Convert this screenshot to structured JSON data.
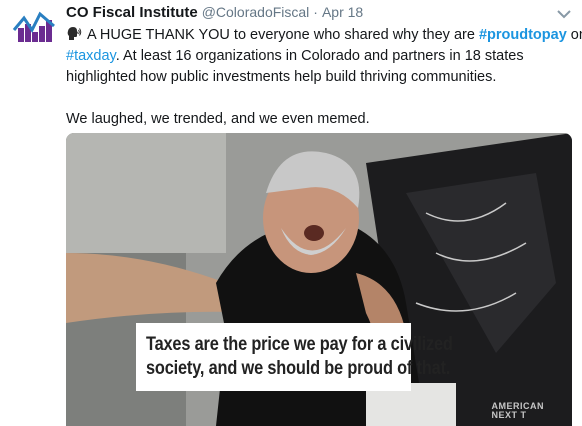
{
  "tweet": {
    "author_name": "CO Fiscal Institute",
    "handle": "@ColoradoFiscal",
    "separator": "·",
    "date": "Apr 18",
    "speaking_icon": "speaking-head-icon",
    "line1_text": "A HUGE THANK YOU to everyone who shared why they are ",
    "hashtag1": "#proudtopay",
    "line1_end": " on",
    "hashtag2": "#taxday",
    "line2_text": ". At least 16 organizations in Colorado and partners in 18 states",
    "line3_text": "highlighted how public investments help build thriving communities.",
    "line4_text": "We laughed, we trended, and we even memed."
  },
  "media": {
    "caption_line1": "Taxes are the price we pay for a civilized",
    "caption_line2": "society, and we should be proud of that.",
    "watermark_line1": "AMERICAN",
    "watermark_line2": "NEXT T"
  },
  "colors": {
    "hashtag": "#1b95e0",
    "meta_text": "#657786",
    "logo_purple": "#6b2c91",
    "logo_blue": "#2a7fc1"
  }
}
